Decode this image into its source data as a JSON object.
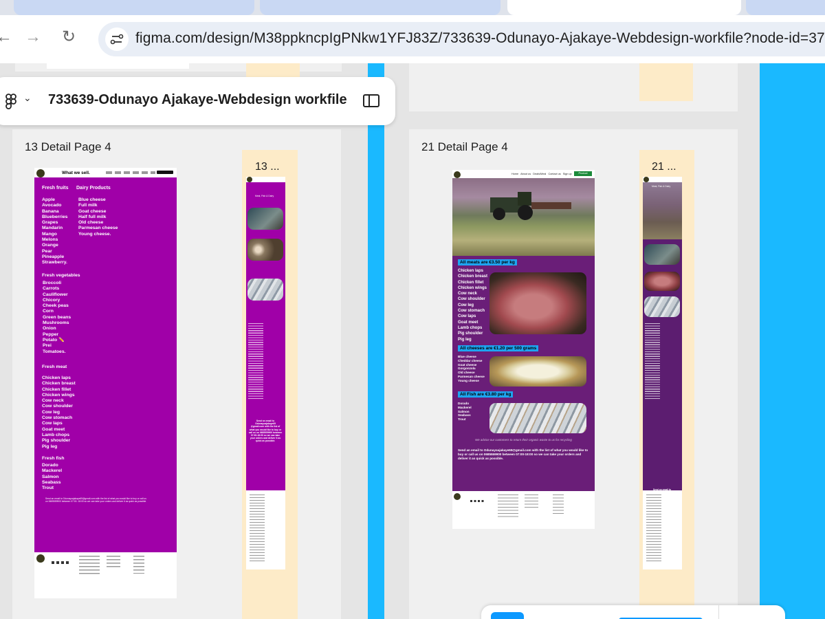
{
  "browser": {
    "url": "figma.com/design/M38ppkncpIgPNkw1YFJ83Z/733639-Odunayo-Ajakaye-Webdesign-workfile?node-id=37-"
  },
  "figma": {
    "file_name": "733639-Odunayo Ajakaye-Webdesign workfile"
  },
  "frames": {
    "left_title": "13 Detail Page 4",
    "left_strip_title": "13 ...",
    "right_title": "21 Detail Page 4",
    "right_strip_title": "21 ..."
  },
  "page13": {
    "heading": "What we sell.",
    "fruits_header": "Fresh fruits",
    "fruits": [
      "Apple",
      "Avocado",
      "Banana",
      "Blueberries",
      "Grapes",
      "Mandarin",
      "Mango",
      "Melons",
      "Orange",
      "Pear",
      "Pineapple",
      "Strawberry."
    ],
    "dairy_header": "Dairy Products",
    "dairy": [
      "Blue cheese",
      "Full milk",
      "Goat cheese",
      "Half full milk",
      "Old cheese",
      "Parmesan cheese",
      "Young cheese."
    ],
    "veg_header": "Fresh vegetables",
    "veg": [
      "Broccoli",
      "Carrots",
      "Cauliflower",
      "Chicory",
      "Cheek peas",
      "Corn",
      "Green beans",
      "Mushrooms",
      "Onion",
      "Pepper",
      "Potato ✏️",
      "Prei",
      "Tomatoes."
    ],
    "meat_header": "Fresh meat",
    "meat": [
      "Chicken laps",
      "Chicken breast",
      "Chicken fillet",
      "Chicken wings",
      "Cow neck",
      "Cow shoulder",
      "Cow leg",
      "Cow stomach",
      "Cow laps",
      "Goat meet",
      "Lamb chops",
      "Pig shoulder",
      "Pig leg"
    ],
    "fish_header": "Fresh fish",
    "fish": [
      "Dorado",
      "Mackerel",
      "Salmon",
      "Seabass",
      "Trout"
    ],
    "email_note": "Send an email to Odunayoajakaye69@gmail.com with the list of what you would like to buy or call us on 0685559900 between 07:00- 18:00 so we can take your orders and deliver it as quick as possible."
  },
  "page21": {
    "nav": [
      "Home",
      "About us",
      "Deals/Meal",
      "Contact us",
      "Sign up"
    ],
    "nav_button": "Product",
    "meats_label": "All meats are €3.50 per kg",
    "meats": [
      "Chicken laps",
      "Chicken breast",
      "Chicken fillet",
      "Chicken wings",
      "Cow neck",
      "Cow shoulder",
      "Cow leg",
      "Cow stomach",
      "Cow laps",
      "Goat meet",
      "Lamb chops",
      "Pig shoulder",
      "Pig leg"
    ],
    "cheese_label": "All cheeses are €1.20 per 500 grams",
    "cheeses": [
      "Blue cheese",
      "Cheddar cheese",
      "Goat cheese",
      "Gorgonzola",
      "Old cheese",
      "Parmesan cheese",
      "Young cheese"
    ],
    "fish_label": "All Fish are €3.80 per kg",
    "fish": [
      "Dorado",
      "Mackerel",
      "Salmon",
      "Seabass",
      "Trout"
    ],
    "advice": "We advice our customers to return their organic waste to us for recycling",
    "email_note": "Send an email to Odunayoajakaye69@gmail.com with the list of what you would like to buy or call us on 0685559900 between 07:00-18:00 so we can take your orders and deliver it as quick as possible."
  },
  "strip": {
    "email_note": "Send an email to Odunayoajakaye69 @gmail.com with the list of what you would like to buy or call us on 0685559900 between 07:00-18:00 so we can take your orders and deliver it as quick as possible.",
    "strip_label": "Meat, Fish & Dairy"
  },
  "colors": {
    "purple": "#a000a8",
    "deep_purple": "#6a1e78",
    "accent_blue": "#1ea4f0",
    "canvas_cyan": "#1ab9ff"
  }
}
